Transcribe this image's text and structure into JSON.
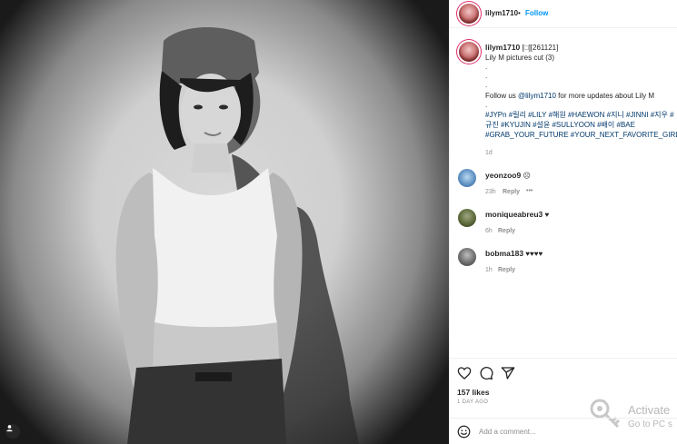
{
  "post": {
    "username": "lilym1710",
    "separator": "•",
    "follow_label": "Follow"
  },
  "caption": {
    "username": "lilym1710",
    "title": "[□][261121]",
    "line1": "Lily M pictures cut (3)",
    "dot1": ".",
    "dot2": ".",
    "dot3": ".",
    "follow_pre": "Follow us ",
    "follow_mention": "@lilym1710",
    "follow_post": " for more updates about Lily M",
    "dot4": ".",
    "hashtags_line1": "#JYPn #릴리 #LILY #해원 #HAEWON #지니 #JINNI #지우 #",
    "hashtags_line2": "규진 #KYUJIN #설윤 #SULLYOON #배이 #BAE",
    "hashtags_line3": "#GRAB_YOUR_FUTURE #YOUR_NEXT_FAVORITE_GIRL_GRO",
    "time": "1d"
  },
  "comments": [
    {
      "username": "yeonzoo9",
      "text": "☹",
      "time": "23h",
      "reply": "Reply",
      "more": "•••"
    },
    {
      "username": "moniqueabreu3",
      "text": "♥",
      "time": "6h",
      "reply": "Reply"
    },
    {
      "username": "bobma183",
      "text": "♥♥♥♥",
      "time": "1h",
      "reply": "Reply"
    }
  ],
  "likes": "157 likes",
  "date": "1 DAY AGO",
  "add_comment_placeholder": "Add a comment...",
  "watermark": {
    "line1": "Activate",
    "line2": "Go to PC s"
  },
  "icons": [
    "heart-icon",
    "comment-icon",
    "share-icon",
    "emoji-icon",
    "tag-user-icon",
    "key-icon"
  ]
}
